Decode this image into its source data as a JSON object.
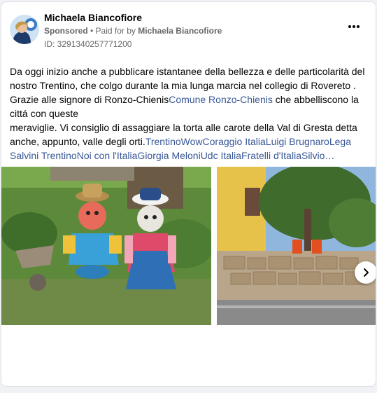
{
  "post": {
    "author": "Michaela Biancofiore",
    "sponsored": "Sponsored",
    "separator": " • ",
    "paid_for_by": "Paid for by ",
    "paid_for_name": "Michaela Biancofiore",
    "ad_id": "ID: 3291340257771200",
    "more_icon": "more-horizontal-icon",
    "text": {
      "p1": "Da oggi inizio anche a pubblicare istantanee della bellezza e delle particolarità del nostro Trentino, che colgo durante la mia lunga marcia nel collegio di Rovereto .",
      "p2a": "Grazie alle signore di Ronzo-Chienis",
      "p2_link": "Comune Ronzo-Chienis",
      "p2b": " che abbelliscono la cittá con queste",
      "p3": "meraviglie. Vi consiglio di assaggiare la torta alle carote della Val di Gresta detta anche, appunto, valle degli orti.",
      "hashtags": "TrentinoWowCoraggio ItaliaLuigi BrugnaroLega Salvini TrentinoNoi con l'ItaliaGiorgia MeloniUdc ItaliaFratelli d'ItaliaSilvio…"
    },
    "colors": {
      "link": "#385898",
      "meta": "#65676b",
      "text": "#050505"
    },
    "carousel": {
      "next_icon": "chevron-right-icon"
    }
  }
}
